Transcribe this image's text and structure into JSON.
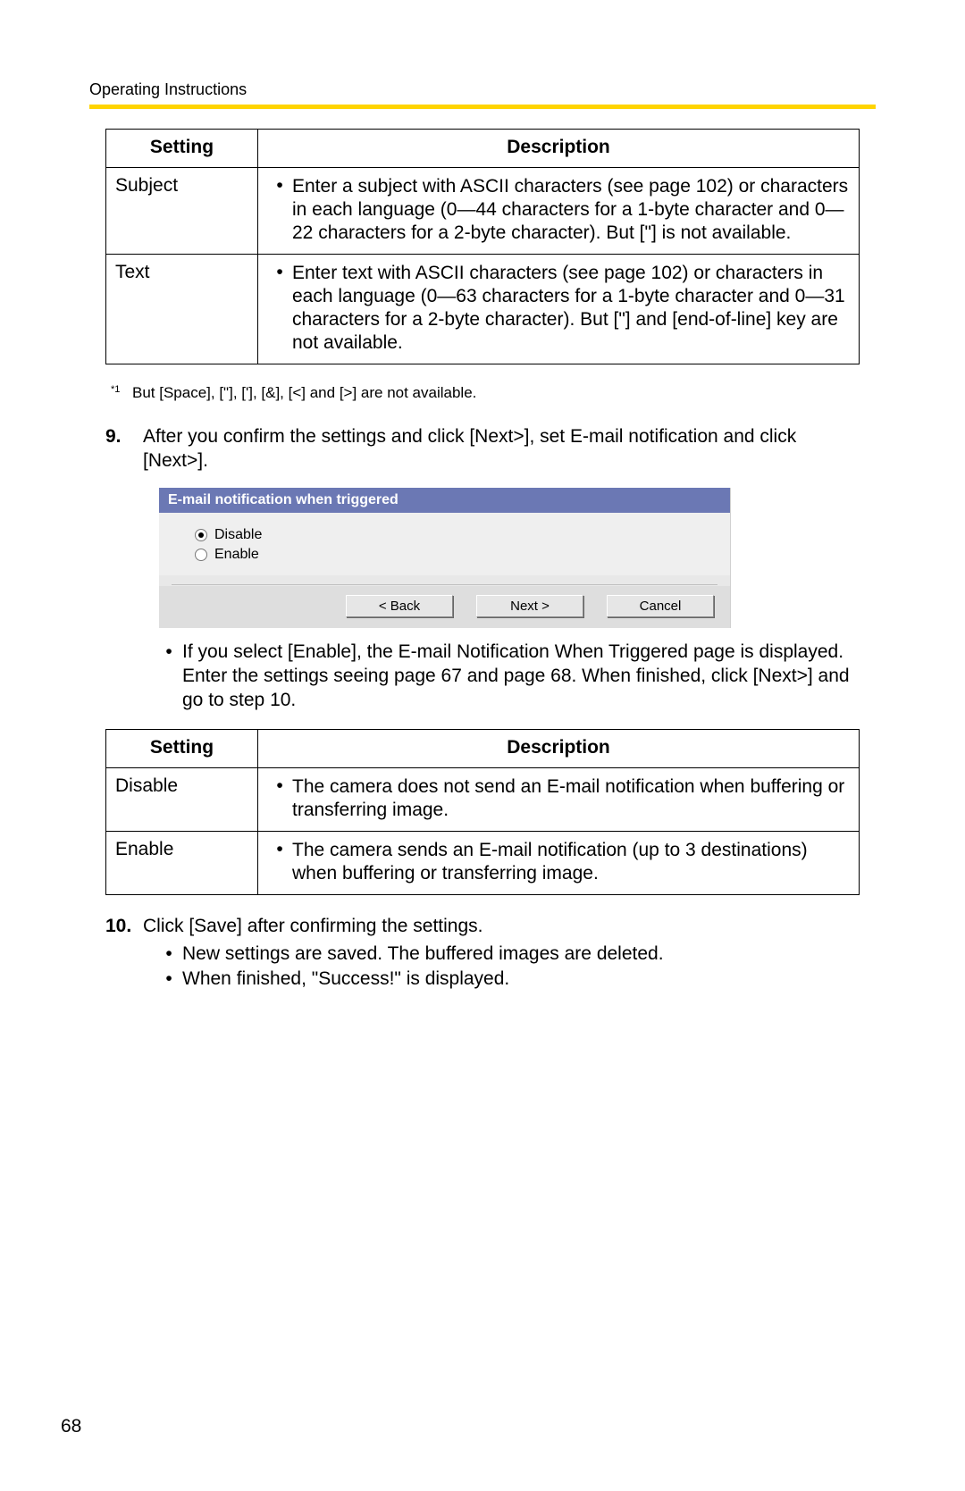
{
  "header": "Operating Instructions",
  "pageNumber": "68",
  "table1": {
    "colSetting": "Setting",
    "colDesc": "Description",
    "rows": [
      {
        "setting": "Subject",
        "desc": "Enter a subject with ASCII characters (see page 102) or characters in each language (0—44 characters for a 1-byte character and 0—22 characters for a 2-byte character). But [\"] is not available."
      },
      {
        "setting": "Text",
        "desc": "Enter text with ASCII characters (see page 102) or characters in each language (0—63 characters for a 1-byte character and 0—31 characters for a 2-byte character). But [\"] and [end-of-line] key are not available."
      }
    ]
  },
  "footnote": {
    "mark": "*1",
    "text": "But [Space], [\"], ['], [&], [<] and [>] are not available."
  },
  "step9": {
    "num": "9.",
    "text": "After you confirm the settings and click [Next>], set E-mail notification and click [Next>]."
  },
  "dialog": {
    "title": "E-mail notification when triggered",
    "optDisable": "Disable",
    "optEnable": "Enable",
    "btnBack": "<  Back",
    "btnNext": "Next  >",
    "btnCancel": "Cancel"
  },
  "step9note": "If you select [Enable], the E-mail Notification When Triggered page is displayed. Enter the settings seeing page 67 and page 68. When finished, click [Next>] and go to step 10.",
  "table2": {
    "colSetting": "Setting",
    "colDesc": "Description",
    "rows": [
      {
        "setting": "Disable",
        "desc": "The camera does not send an E-mail notification when buffering or transferring image."
      },
      {
        "setting": "Enable",
        "desc": "The camera sends an E-mail notification (up to 3 destinations) when buffering or transferring image."
      }
    ]
  },
  "step10": {
    "num": "10.",
    "text": "Click [Save] after confirming the settings.",
    "bullets": [
      "New settings are saved. The buffered images are deleted.",
      "When finished, \"Success!\" is displayed."
    ]
  }
}
